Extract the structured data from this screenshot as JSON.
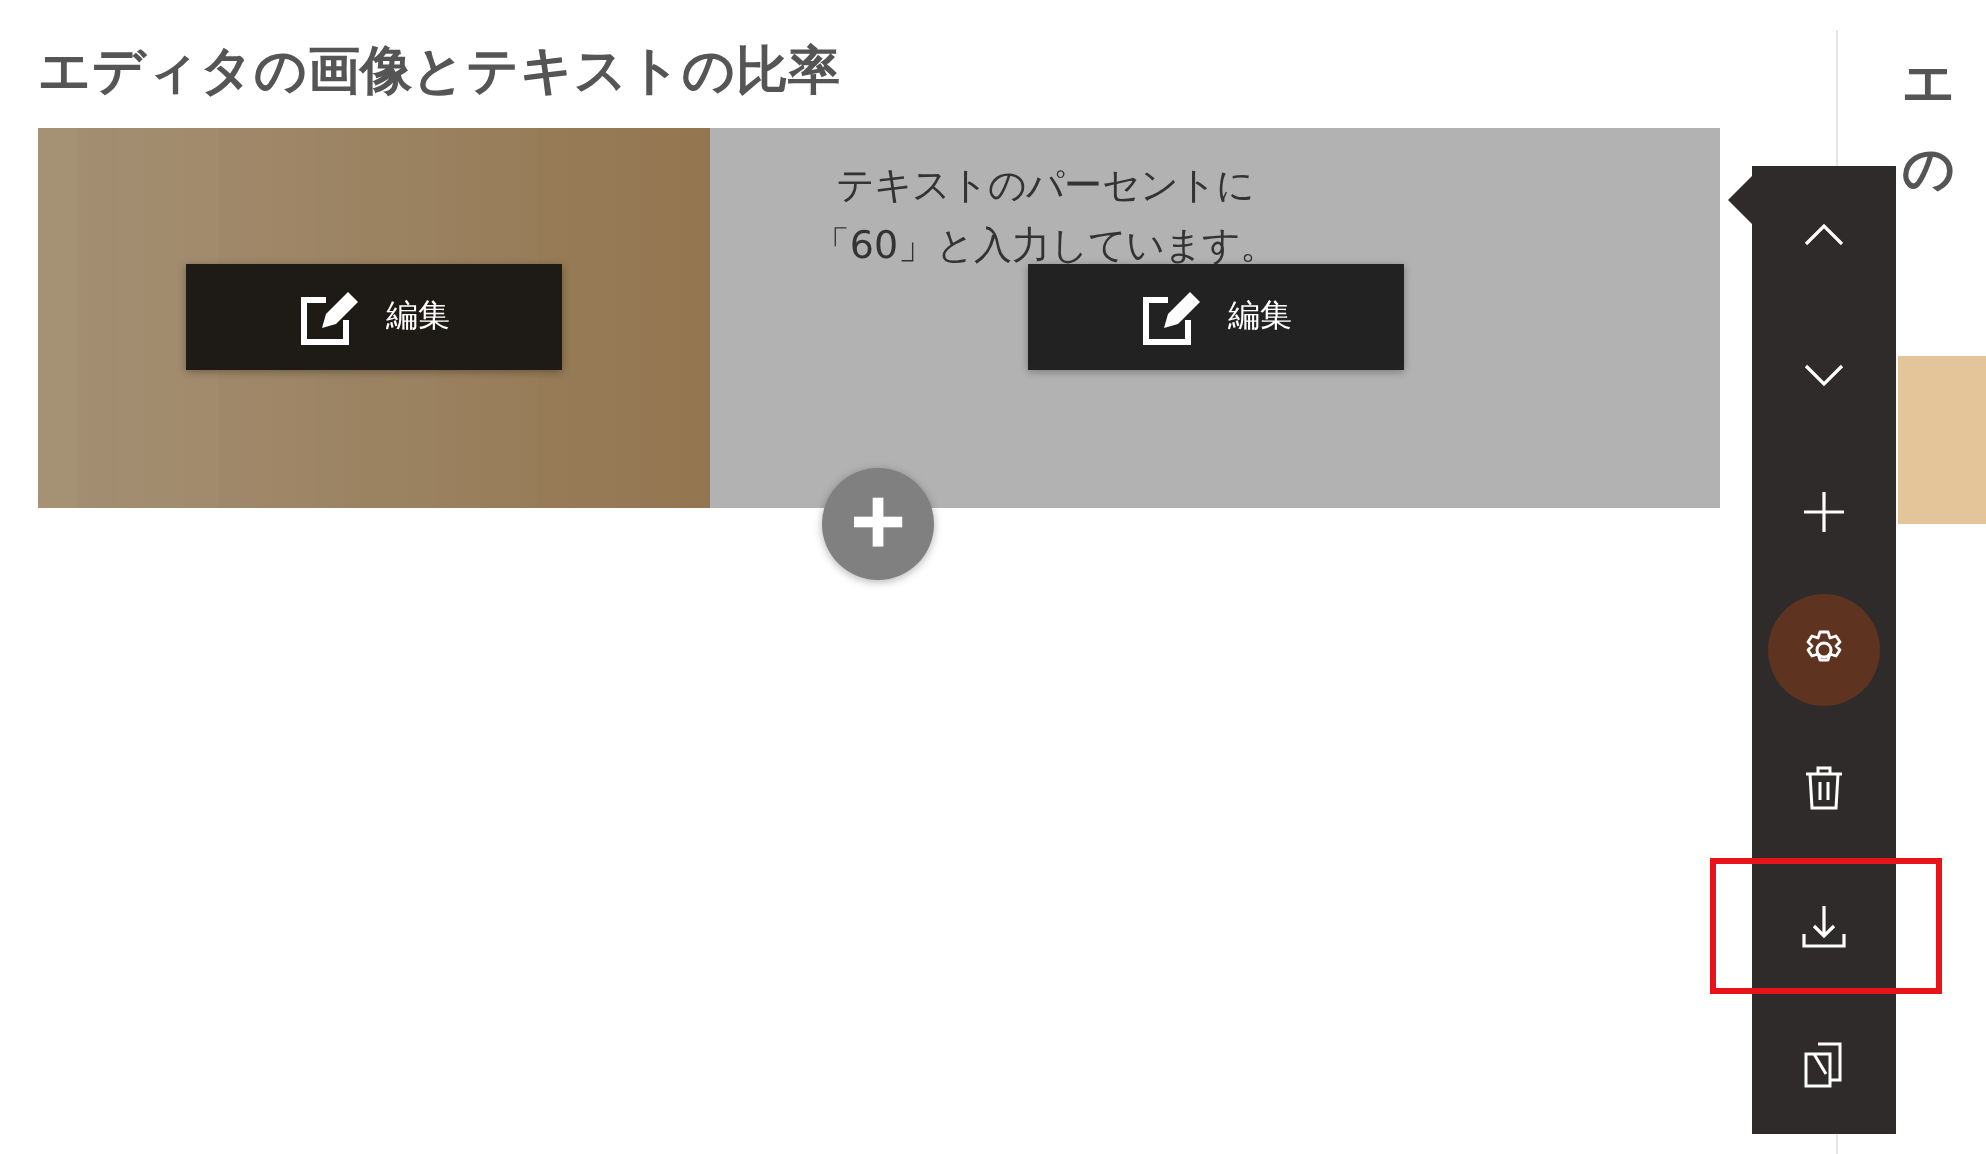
{
  "heading": "エディタの画像とテキストの比率",
  "block": {
    "image": {
      "kind": "picture",
      "edit_label": "編集"
    },
    "text": {
      "lines": [
        "テキストのパーセントに",
        "「60」と入力しています。"
      ],
      "edit_label": "編集"
    },
    "add_label": "+"
  },
  "next_heading_lines": [
    "エ",
    "の"
  ],
  "toolbar": [
    {
      "kind": "up",
      "active": false,
      "highlighted": false
    },
    {
      "kind": "down",
      "active": false,
      "highlighted": false
    },
    {
      "kind": "add",
      "active": false,
      "highlighted": false
    },
    {
      "kind": "settings",
      "active": true,
      "highlighted": false
    },
    {
      "kind": "delete",
      "active": false,
      "highlighted": false
    },
    {
      "kind": "download",
      "active": false,
      "highlighted": true
    },
    {
      "kind": "copy",
      "active": false,
      "highlighted": false
    }
  ]
}
